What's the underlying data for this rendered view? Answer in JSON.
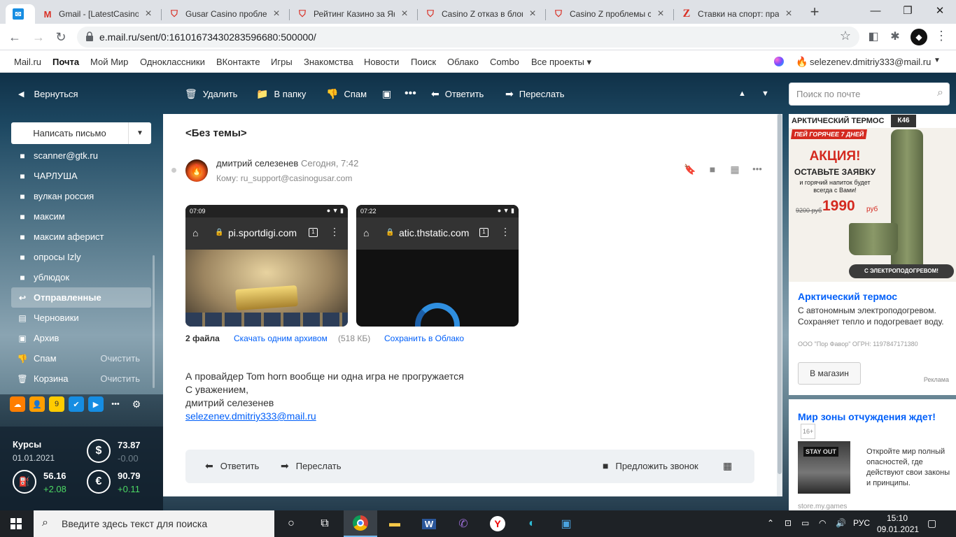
{
  "browser": {
    "tabs": [
      {
        "title": "Gmail - [LatestCasinoB",
        "icon": "gmail-icon"
      },
      {
        "title": "Gusar Casino проблем",
        "icon": "puzzle-icon"
      },
      {
        "title": "Рейтинг Казино за Ян",
        "icon": "puzzle-icon"
      },
      {
        "title": "Casino Z отказ в блок",
        "icon": "puzzle-icon"
      },
      {
        "title": "Casino Z проблемы с",
        "icon": "puzzle-icon"
      },
      {
        "title": "Ставки на спорт: пра",
        "icon": "z-icon"
      }
    ],
    "url": "e.mail.ru/sent/0:16101673430283596680:500000/"
  },
  "portal": {
    "links": [
      "Mail.ru",
      "Почта",
      "Мой Мир",
      "Одноклассники",
      "ВКонтакте",
      "Игры",
      "Знакомства",
      "Новости",
      "Поиск",
      "Облако",
      "Combo",
      "Все проекты ▾"
    ],
    "user": "selezenev.dmitriy333@mail.ru"
  },
  "toolbar": {
    "back": "Вернуться",
    "delete": "Удалить",
    "to_folder": "В папку",
    "spam": "Спам",
    "reply": "Ответить",
    "forward": "Переслать",
    "search_placeholder": "Поиск по почте"
  },
  "sidebar": {
    "compose": "Написать письмо",
    "folders": [
      {
        "label": "scanner@gtk.ru",
        "icon": "folder-icon",
        "action": ""
      },
      {
        "label": "ЧАРЛУША",
        "icon": "folder-icon",
        "action": ""
      },
      {
        "label": "вулкан россия",
        "icon": "folder-icon",
        "action": ""
      },
      {
        "label": "максим",
        "icon": "folder-icon",
        "action": ""
      },
      {
        "label": "максим аферист",
        "icon": "folder-icon",
        "action": ""
      },
      {
        "label": "опросы Izly",
        "icon": "folder-icon",
        "action": ""
      },
      {
        "label": "ублюдок",
        "icon": "folder-icon",
        "action": ""
      },
      {
        "label": "Отправленные",
        "icon": "sent-icon",
        "action": ""
      },
      {
        "label": "Черновики",
        "icon": "draft-icon",
        "action": ""
      },
      {
        "label": "Архив",
        "icon": "archive-icon",
        "action": ""
      },
      {
        "label": "Спам",
        "icon": "spam-icon",
        "action": "Очистить"
      },
      {
        "label": "Корзина",
        "icon": "trash-icon",
        "action": "Очистить"
      }
    ],
    "rates": {
      "title": "Курсы",
      "date": "01.01.2021",
      "usd": "73.87",
      "usd_delta": "-0.00",
      "oil": "56.16",
      "oil_delta": "+2.08",
      "eur": "90.79",
      "eur_delta": "+0.11"
    }
  },
  "message": {
    "subject": "<Без темы>",
    "from": "дмитрий селезенев",
    "time": "Сегодня, 7:42",
    "to": "Кому: ru_support@casinogusar.com",
    "screenshots": [
      {
        "time": "07:09",
        "url": "pi.sportdigi.com"
      },
      {
        "time": "07:22",
        "url": "atic.thstatic.com"
      }
    ],
    "attach_count": "2 файла",
    "download_all": "Скачать одним архивом",
    "archive_size": "(518 КБ)",
    "save_cloud": "Сохранить в Облако",
    "body": [
      "А провайдер  Tom horn вообще ни одна игра не прогружается",
      "С уважением,",
      "дмитрий селезенев"
    ],
    "email_link": "selezenev.dmitriy333@mail.ru",
    "bottom": {
      "reply": "Ответить",
      "forward": "Переслать",
      "call": "Предложить звонок"
    }
  },
  "ads": {
    "ad1": {
      "header": "АРКТИЧЕСКИЙ ТЕРМОС",
      "badge": "К46",
      "hot": "ПЕЙ ГОРЯЧЕЕ 7 ДНЕЙ",
      "promo": "АКЦИЯ!",
      "cta": "ОСТАВЬТЕ ЗАЯВКУ",
      "gift": "и горячий напиток будет всегда с Вами!",
      "old_price": "9200 руб",
      "price": "1990",
      "currency": "руб",
      "band": "С ЭЛЕКТРОПОДОГРЕВОМ!",
      "title": "Арктический термос",
      "desc": "С автономным электроподогревом. Сохраняет тепло и подогревает воду.",
      "legal": "ООО \"Пор Фавор\" ОГРН: 1197847171380",
      "button": "В магазин",
      "label": "Реклама"
    },
    "ad2": {
      "title": "Мир зоны отчуждения ждет!",
      "age": "16+",
      "image_text": "STAY OUT",
      "desc": "Откройте мир полный опасностей, где действуют свои законы и принципы.",
      "source": "store.my.games"
    }
  },
  "taskbar": {
    "search_placeholder": "Введите здесь текст для поиска",
    "lang": "РУС",
    "time": "15:10",
    "date": "09.01.2021"
  }
}
